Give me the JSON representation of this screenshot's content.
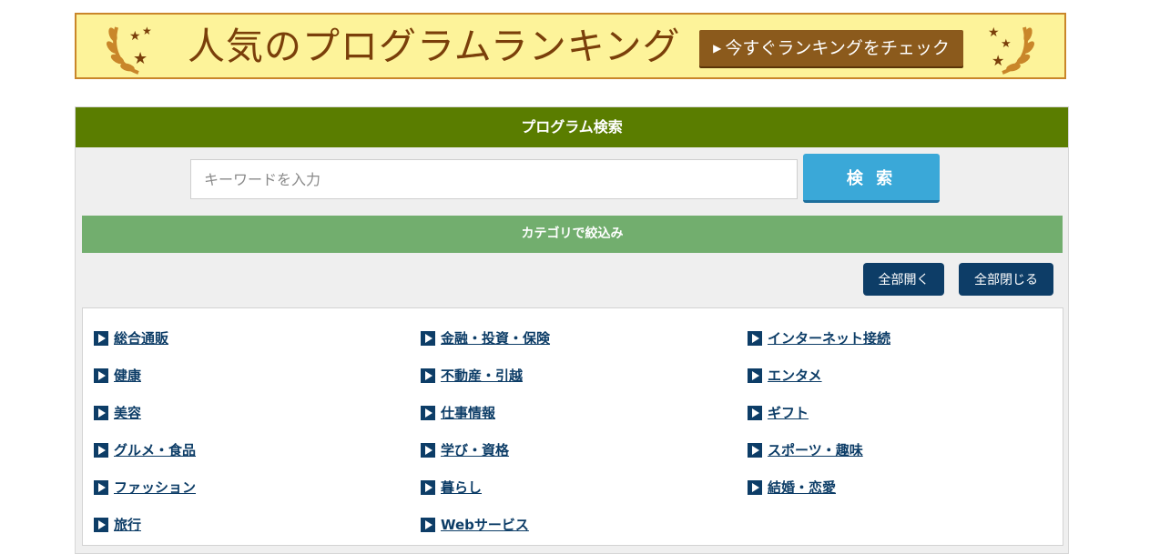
{
  "banner": {
    "title": "人気のプログラムランキング",
    "cta_label": "今すぐランキングをチェック",
    "colors": {
      "background": "#fdf39a",
      "border": "#c9862a",
      "title": "#7a3f0a",
      "cta": "#8b5a1c"
    },
    "icons": [
      "laurel-left-icon",
      "laurel-right-icon",
      "play-triangle-icon"
    ]
  },
  "search": {
    "header": "プログラム検索",
    "placeholder": "キーワードを入力",
    "value": "",
    "button_label": "検 索",
    "colors": {
      "header": "#5a7d00",
      "button": "#3aa8d8"
    }
  },
  "categories": {
    "header": "カテゴリで絞込み",
    "expand_all_label": "全部開く",
    "collapse_all_label": "全部閉じる",
    "colors": {
      "header": "#72ae6e",
      "buttons": "#0d3d67",
      "links": "#0d3d67"
    },
    "columns": [
      [
        {
          "label": "総合通販"
        },
        {
          "label": "健康"
        },
        {
          "label": "美容"
        },
        {
          "label": "グルメ・食品"
        },
        {
          "label": "ファッション"
        },
        {
          "label": "旅行"
        }
      ],
      [
        {
          "label": "金融・投資・保険"
        },
        {
          "label": "不動産・引越"
        },
        {
          "label": "仕事情報"
        },
        {
          "label": "学び・資格"
        },
        {
          "label": "暮らし"
        },
        {
          "label": "Webサービス"
        }
      ],
      [
        {
          "label": "インターネット接続"
        },
        {
          "label": "エンタメ"
        },
        {
          "label": "ギフト"
        },
        {
          "label": "スポーツ・趣味"
        },
        {
          "label": "結婚・恋愛"
        }
      ]
    ]
  }
}
